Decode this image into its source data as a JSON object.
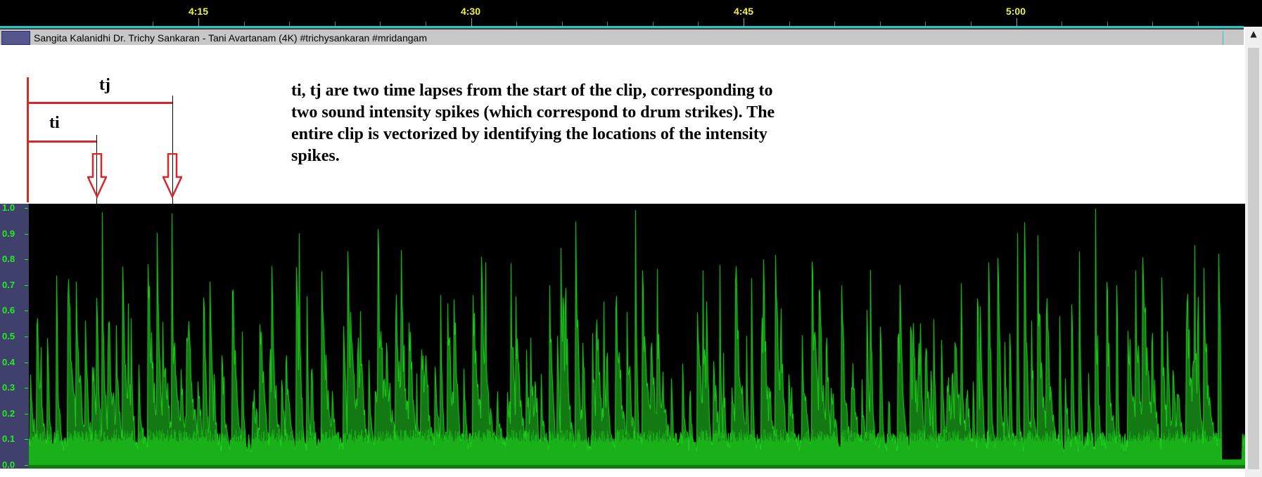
{
  "timeline": {
    "ticks": [
      "4:15",
      "4:30",
      "4:45",
      "5:00"
    ]
  },
  "clip": {
    "title": "Sangita Kalanidhi Dr. Trichy Sankaran - Tani Avartanam (4K) #trichysankaran #mridangam"
  },
  "annotation": {
    "label_ti": "ti",
    "label_tj": "tj",
    "text": "ti, tj are two time lapses from the start of the clip, corresponding to two sound intensity spikes (which correspond to drum strikes). The entire clip is vectorized by identifying the locations of the intensity spikes."
  },
  "waveform": {
    "y_ticks": [
      "1.0",
      "0.9",
      "0.8",
      "0.7",
      "0.6",
      "0.5",
      "0.4",
      "0.3",
      "0.2",
      "0.1",
      "0.0"
    ],
    "colors": {
      "wave": "#22dd22",
      "fill": "#0f7a0f",
      "background": "#000000",
      "axis": "#40406c"
    }
  }
}
